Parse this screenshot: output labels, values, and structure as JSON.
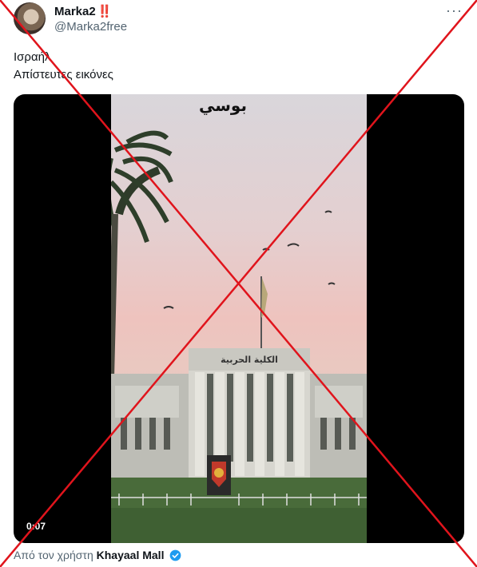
{
  "post": {
    "display_name": "Marka2",
    "name_emoji": "‼️",
    "handle": "@Marka2free",
    "more_label": "···",
    "text_line1": "Ισραήλ",
    "text_line2": "Απίστευτες εικόνες"
  },
  "video": {
    "timestamp": "0:07",
    "caption_arabic": "بوسي",
    "building_sign": "الكلية الحربية"
  },
  "footer": {
    "prefix": "Από τον χρήστη",
    "source_user": "Khayaal Mall"
  },
  "colors": {
    "cross": "#e0141c",
    "verified": "#1d9bf0"
  }
}
